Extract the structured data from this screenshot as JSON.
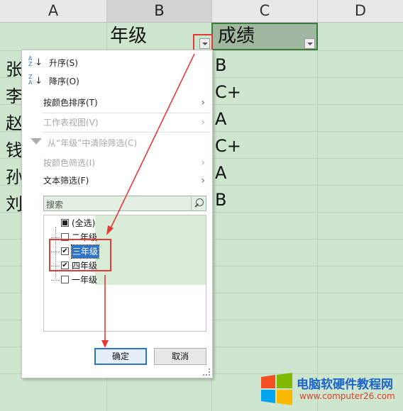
{
  "columns": [
    {
      "label": "A"
    },
    {
      "label": "B"
    },
    {
      "label": "C"
    },
    {
      "label": "D"
    }
  ],
  "header_cells": {
    "b1": "年级",
    "c1": "成绩"
  },
  "names": [
    "张",
    "李",
    "赵",
    "钱",
    "孙",
    "刘"
  ],
  "grades": [
    "B",
    "C+",
    "A",
    "C+",
    "A",
    "B"
  ],
  "menu": {
    "sort_asc": "升序(S)",
    "sort_desc": "降序(O)",
    "sort_by_color": "按颜色排序(T)",
    "sheet_view": "工作表视图(V)",
    "clear_filter": "从“年级”中清除筛选(C)",
    "filter_by_color": "按颜色筛选(I)",
    "text_filter": "文本筛选(F)",
    "search_placeholder": "搜索",
    "items": [
      {
        "label": "(全选)",
        "state": "partial"
      },
      {
        "label": "二年级",
        "state": "unchecked"
      },
      {
        "label": "三年级",
        "state": "checked"
      },
      {
        "label": "四年级",
        "state": "checked"
      },
      {
        "label": "一年级",
        "state": "unchecked"
      }
    ],
    "ok_label": "确定",
    "cancel_label": "取消"
  },
  "watermark": {
    "title": "电脑软硬件教程网",
    "url": "www.computer26.com"
  },
  "colors": {
    "annotation_red": "#e53935",
    "cell_green": "#cde6cd",
    "header_c_fill": "#9fb89f",
    "accent_blue": "#2e74c8"
  },
  "icons": {
    "sort_asc": "sort-ascending-icon",
    "sort_desc": "sort-descending-icon",
    "clear_filter": "funnel-clear-icon",
    "search": "search-icon",
    "dropdown": "dropdown-arrow-icon",
    "submenu": "chevron-right-icon"
  }
}
